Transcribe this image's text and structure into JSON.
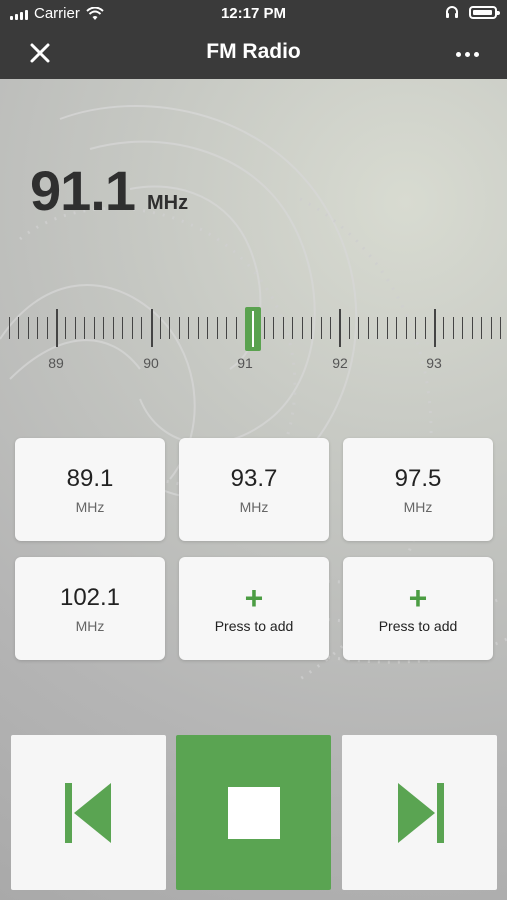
{
  "status_bar": {
    "carrier": "Carrier",
    "time": "12:17 PM"
  },
  "navbar": {
    "title": "FM Radio"
  },
  "frequency": {
    "value": "91.1",
    "unit": "MHz"
  },
  "tuner": {
    "labels": [
      "89",
      "90",
      "91",
      "92",
      "93"
    ],
    "current": 91.1
  },
  "presets": [
    {
      "value": "89.1",
      "unit": "MHz"
    },
    {
      "value": "93.7",
      "unit": "MHz"
    },
    {
      "value": "97.5",
      "unit": "MHz"
    },
    {
      "value": "102.1",
      "unit": "MHz"
    },
    {
      "label": "Press to add"
    },
    {
      "label": "Press to add"
    }
  ],
  "colors": {
    "accent": "#5aa452",
    "header": "#3a3a3a"
  }
}
